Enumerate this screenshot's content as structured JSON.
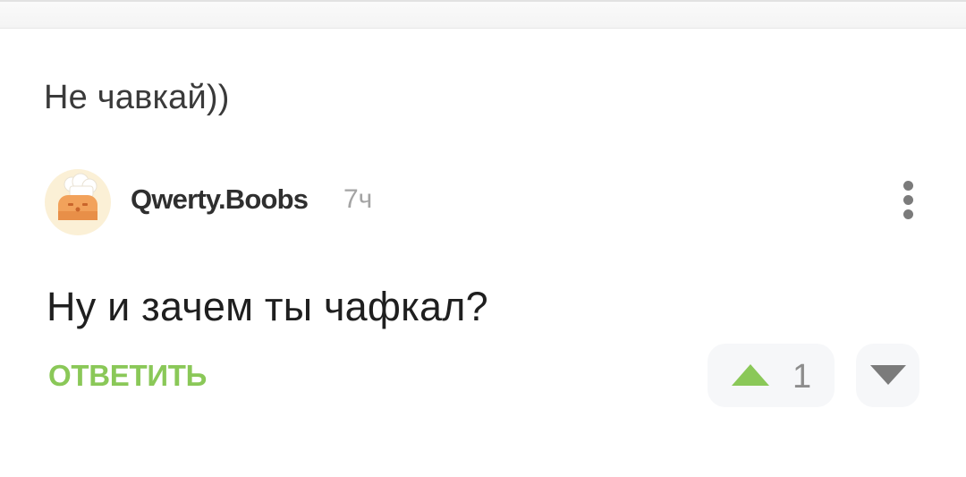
{
  "previous_comment": {
    "text": "Не чавкай))"
  },
  "comment": {
    "username": "Qwerty.Boobs",
    "time": "7ч",
    "text": "Ну и зачем ты чафкал?",
    "reply_label": "ОТВЕТИТЬ",
    "votes": "1",
    "avatar_icon": "chef-hat-avatar",
    "more_icon": "vertical-dots-icon",
    "upvote_icon": "triangle-up-icon",
    "downvote_icon": "triangle-down-icon"
  },
  "colors": {
    "accent": "#8ac858",
    "upvote": "#8ac858",
    "downvote": "#7b7b7b",
    "text": "#1f1f1f",
    "muted": "#a4a4a4"
  }
}
